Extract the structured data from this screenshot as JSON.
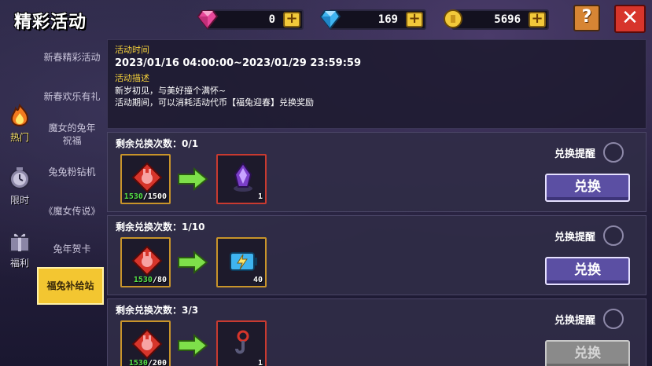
{
  "header": {
    "title": "精彩活动",
    "currencies": [
      {
        "icon": "pink-gem-icon",
        "amount": "0",
        "color": "#e8479a"
      },
      {
        "icon": "blue-gem-icon",
        "amount": "169",
        "color": "#3fb4f0"
      },
      {
        "icon": "gold-coin-icon",
        "amount": "5696",
        "color": "#f2c93a"
      }
    ],
    "plus_label": "+",
    "help_label": "?",
    "close_label": "✕"
  },
  "rail": {
    "items": [
      {
        "label": "热门",
        "icon": "flame-icon",
        "active": true
      },
      {
        "label": "限时",
        "icon": "clock-icon",
        "active": false
      },
      {
        "label": "福利",
        "icon": "gift-icon",
        "active": false
      }
    ]
  },
  "submenu": {
    "items": [
      {
        "label": "新春精彩活动"
      },
      {
        "label": "新春欢乐有礼"
      },
      {
        "label": "魔女的兔年祝福"
      },
      {
        "label": "兔兔粉钻机"
      },
      {
        "label": "《魔女传说》"
      },
      {
        "label": "兔年贺卡"
      },
      {
        "label": "福兔补给站",
        "active": true
      }
    ]
  },
  "info": {
    "time_heading": "活动时间",
    "time_value": "2023/01/16 04:00:00~2023/01/29 23:59:59",
    "desc_heading": "活动描述",
    "desc_line1": "新岁初见，与美好撞个满怀~",
    "desc_line2": "活动期间，可以消耗活动代币【福兔迎春】兑换奖励"
  },
  "rows": [
    {
      "remain": "剩余兑换次数：0/1",
      "cost_have": "1530",
      "cost_need": "/1500",
      "reward_count": "1",
      "reward_icon": "purple-crystal-icon",
      "remind_label": "兑换提醒",
      "button_label": "兑换",
      "enabled": true
    },
    {
      "remain": "剩余兑换次数：1/10",
      "cost_have": "1530",
      "cost_need": "/80",
      "reward_count": "40",
      "reward_icon": "energy-battery-icon",
      "remind_label": "兑换提醒",
      "button_label": "兑换",
      "enabled": true
    },
    {
      "remain": "剩余兑换次数：3/3",
      "cost_have": "1530",
      "cost_need": "/200",
      "reward_count": "1",
      "reward_icon": "red-hook-icon",
      "remind_label": "兑换提醒",
      "button_label": "兑换",
      "enabled": false
    }
  ]
}
